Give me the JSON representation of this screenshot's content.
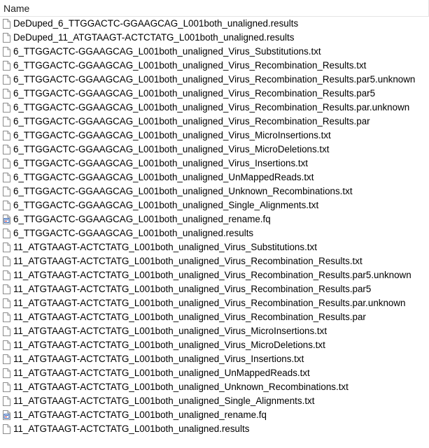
{
  "header": {
    "name_label": "Name"
  },
  "files": [
    {
      "name": "DeDuped_6_TTGGACTC-GGAAGCAG_L001both_unaligned.results",
      "icon": "file-icon"
    },
    {
      "name": "DeDuped_11_ATGTAAGT-ACTCTATG_L001both_unaligned.results",
      "icon": "file-icon"
    },
    {
      "name": "6_TTGGACTC-GGAAGCAG_L001both_unaligned_Virus_Substitutions.txt",
      "icon": "file-icon"
    },
    {
      "name": "6_TTGGACTC-GGAAGCAG_L001both_unaligned_Virus_Recombination_Results.txt",
      "icon": "file-icon"
    },
    {
      "name": "6_TTGGACTC-GGAAGCAG_L001both_unaligned_Virus_Recombination_Results.par5.unknown",
      "icon": "file-icon"
    },
    {
      "name": "6_TTGGACTC-GGAAGCAG_L001both_unaligned_Virus_Recombination_Results.par5",
      "icon": "file-icon"
    },
    {
      "name": "6_TTGGACTC-GGAAGCAG_L001both_unaligned_Virus_Recombination_Results.par.unknown",
      "icon": "file-icon"
    },
    {
      "name": "6_TTGGACTC-GGAAGCAG_L001both_unaligned_Virus_Recombination_Results.par",
      "icon": "file-icon"
    },
    {
      "name": "6_TTGGACTC-GGAAGCAG_L001both_unaligned_Virus_MicroInsertions.txt",
      "icon": "file-icon"
    },
    {
      "name": "6_TTGGACTC-GGAAGCAG_L001both_unaligned_Virus_MicroDeletions.txt",
      "icon": "file-icon"
    },
    {
      "name": "6_TTGGACTC-GGAAGCAG_L001both_unaligned_Virus_Insertions.txt",
      "icon": "file-icon"
    },
    {
      "name": "6_TTGGACTC-GGAAGCAG_L001both_unaligned_UnMappedReads.txt",
      "icon": "file-icon"
    },
    {
      "name": "6_TTGGACTC-GGAAGCAG_L001both_unaligned_Unknown_Recombinations.txt",
      "icon": "file-icon"
    },
    {
      "name": "6_TTGGACTC-GGAAGCAG_L001both_unaligned_Single_Alignments.txt",
      "icon": "file-icon"
    },
    {
      "name": "6_TTGGACTC-GGAAGCAG_L001both_unaligned_rename.fq",
      "icon": "fq-file-icon"
    },
    {
      "name": "6_TTGGACTC-GGAAGCAG_L001both_unaligned.results",
      "icon": "file-icon"
    },
    {
      "name": "11_ATGTAAGT-ACTCTATG_L001both_unaligned_Virus_Substitutions.txt",
      "icon": "file-icon"
    },
    {
      "name": "11_ATGTAAGT-ACTCTATG_L001both_unaligned_Virus_Recombination_Results.txt",
      "icon": "file-icon"
    },
    {
      "name": "11_ATGTAAGT-ACTCTATG_L001both_unaligned_Virus_Recombination_Results.par5.unknown",
      "icon": "file-icon"
    },
    {
      "name": "11_ATGTAAGT-ACTCTATG_L001both_unaligned_Virus_Recombination_Results.par5",
      "icon": "file-icon"
    },
    {
      "name": "11_ATGTAAGT-ACTCTATG_L001both_unaligned_Virus_Recombination_Results.par.unknown",
      "icon": "file-icon"
    },
    {
      "name": "11_ATGTAAGT-ACTCTATG_L001both_unaligned_Virus_Recombination_Results.par",
      "icon": "file-icon"
    },
    {
      "name": "11_ATGTAAGT-ACTCTATG_L001both_unaligned_Virus_MicroInsertions.txt",
      "icon": "file-icon"
    },
    {
      "name": "11_ATGTAAGT-ACTCTATG_L001both_unaligned_Virus_MicroDeletions.txt",
      "icon": "file-icon"
    },
    {
      "name": "11_ATGTAAGT-ACTCTATG_L001both_unaligned_Virus_Insertions.txt",
      "icon": "file-icon"
    },
    {
      "name": "11_ATGTAAGT-ACTCTATG_L001both_unaligned_UnMappedReads.txt",
      "icon": "file-icon"
    },
    {
      "name": "11_ATGTAAGT-ACTCTATG_L001both_unaligned_Unknown_Recombinations.txt",
      "icon": "file-icon"
    },
    {
      "name": "11_ATGTAAGT-ACTCTATG_L001both_unaligned_Single_Alignments.txt",
      "icon": "file-icon"
    },
    {
      "name": "11_ATGTAAGT-ACTCTATG_L001both_unaligned_rename.fq",
      "icon": "fq-file-icon"
    },
    {
      "name": "11_ATGTAAGT-ACTCTATG_L001both_unaligned.results",
      "icon": "file-icon"
    }
  ]
}
